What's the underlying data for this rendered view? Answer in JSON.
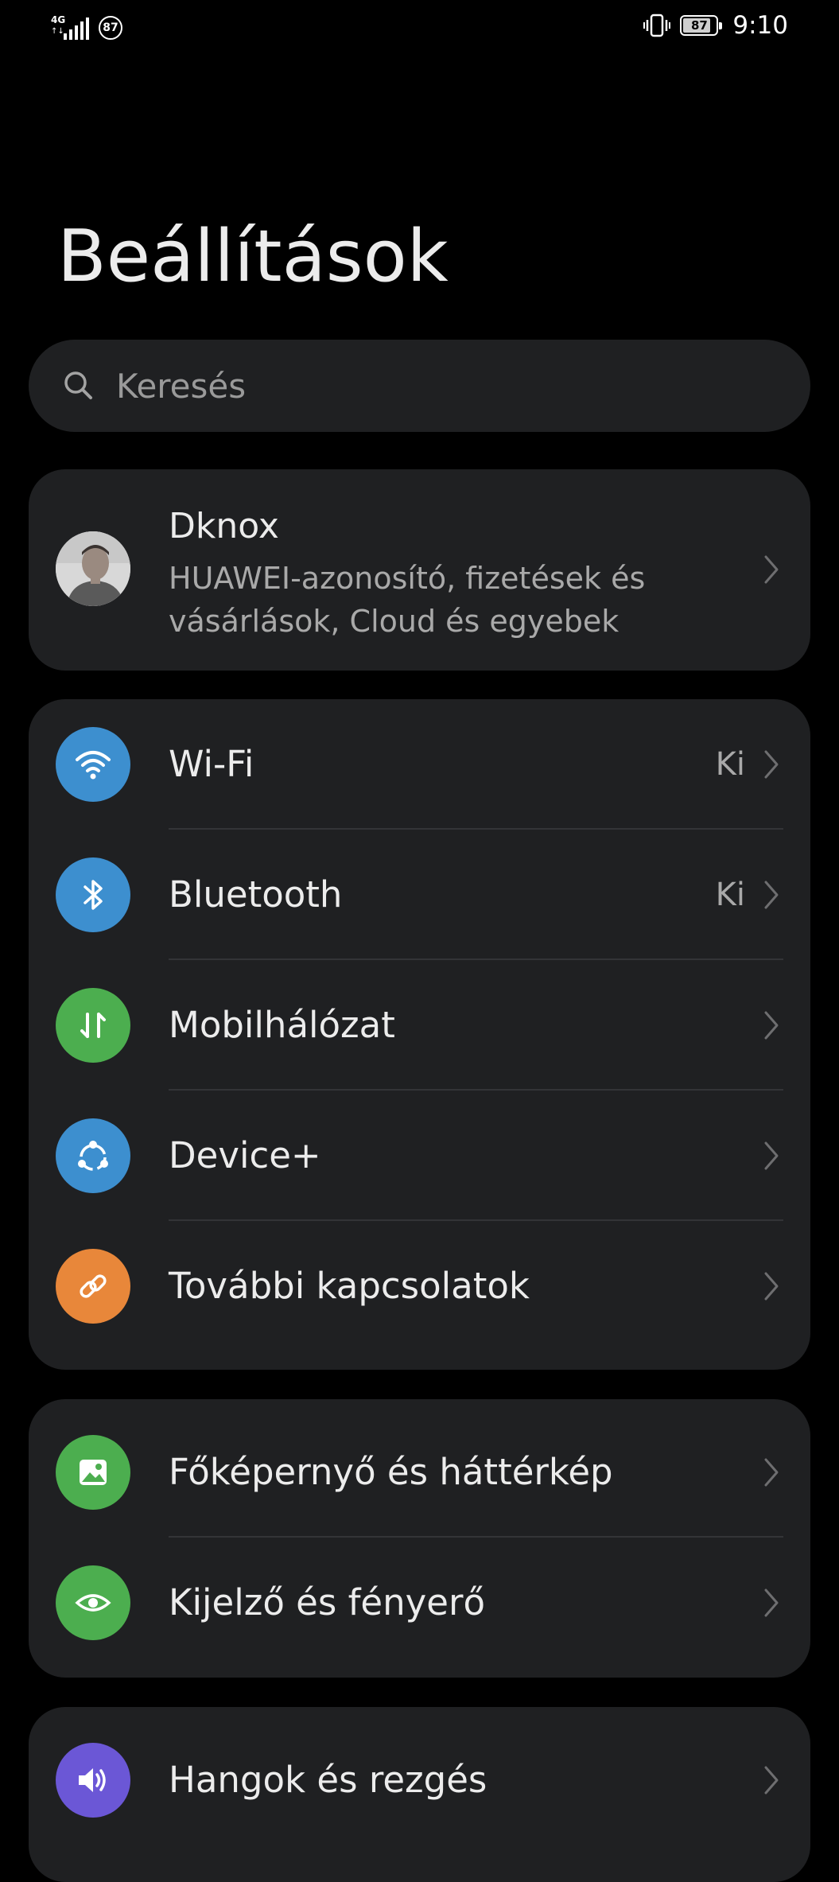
{
  "status_bar": {
    "network_type": "4G",
    "network_sub": "↑↓",
    "notification_count": "87",
    "battery_level": "87",
    "battery_fraction": 0.87,
    "time": "9:10"
  },
  "page": {
    "title": "Beállítások"
  },
  "search": {
    "placeholder": "Keresés"
  },
  "profile": {
    "name": "Dknox",
    "description": "HUAWEI-azonosító, fizetések és vásárlások, Cloud és egyebek"
  },
  "connections": [
    {
      "label": "Wi-Fi",
      "value": "Ki",
      "icon": "wifi-icon",
      "color": "#3d8fcf"
    },
    {
      "label": "Bluetooth",
      "value": "Ki",
      "icon": "bluetooth-icon",
      "color": "#3d8fcf"
    },
    {
      "label": "Mobilhálózat",
      "value": "",
      "icon": "mobile-data-icon",
      "color": "#4cae4f"
    },
    {
      "label": "Device+",
      "value": "",
      "icon": "device-plus-icon",
      "color": "#3d8fcf"
    },
    {
      "label": "További kapcsolatok",
      "value": "",
      "icon": "link-icon",
      "color": "#e8873a"
    }
  ],
  "display": [
    {
      "label": "Főképernyő és háttérkép",
      "icon": "wallpaper-icon",
      "color": "#4cae4f"
    },
    {
      "label": "Kijelző és fényerő",
      "icon": "eye-icon",
      "color": "#4cae4f"
    }
  ],
  "sound": [
    {
      "label": "Hangok és rezgés",
      "icon": "speaker-icon",
      "color": "#6b57d6"
    }
  ]
}
